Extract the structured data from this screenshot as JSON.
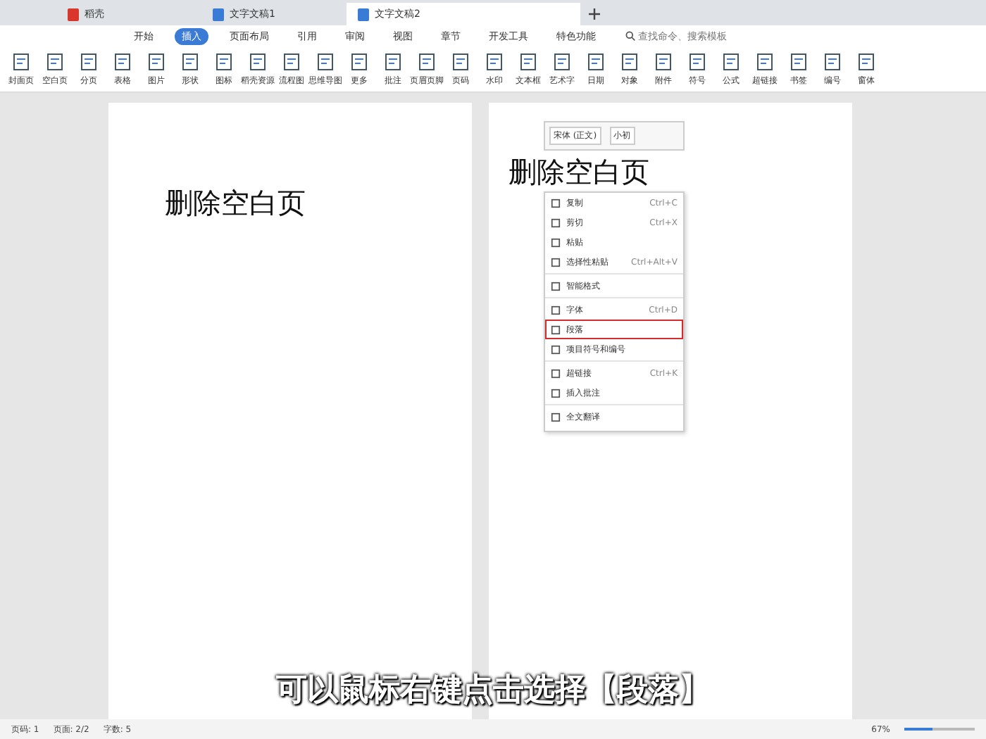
{
  "tabs": [
    {
      "label": "稻壳",
      "kind": "app",
      "selected": false
    },
    {
      "label": "文字文稿1",
      "kind": "doc",
      "selected": false
    },
    {
      "label": "文字文稿2",
      "kind": "doc",
      "selected": true
    }
  ],
  "menu": [
    {
      "label": "开始",
      "selected": false
    },
    {
      "label": "插入",
      "selected": true
    },
    {
      "label": "页面布局",
      "selected": false
    },
    {
      "label": "引用",
      "selected": false
    },
    {
      "label": "审阅",
      "selected": false
    },
    {
      "label": "视图",
      "selected": false
    },
    {
      "label": "章节",
      "selected": false
    },
    {
      "label": "开发工具",
      "selected": false
    },
    {
      "label": "特色功能",
      "selected": false
    }
  ],
  "search": {
    "placeholder": "查找命令、搜索模板"
  },
  "ribbon": [
    {
      "label": "封面页"
    },
    {
      "label": "空白页"
    },
    {
      "label": "分页"
    },
    {
      "label": "表格"
    },
    {
      "label": "图片"
    },
    {
      "label": "形状"
    },
    {
      "label": "图标"
    },
    {
      "label": "稻壳资源"
    },
    {
      "label": "流程图"
    },
    {
      "label": "思维导图"
    },
    {
      "label": "更多"
    },
    {
      "label": "批注"
    },
    {
      "label": "页眉页脚"
    },
    {
      "label": "页码"
    },
    {
      "label": "水印"
    },
    {
      "label": "文本框"
    },
    {
      "label": "艺术字"
    },
    {
      "label": "日期"
    },
    {
      "label": "对象"
    },
    {
      "label": "附件"
    },
    {
      "label": "符号"
    },
    {
      "label": "公式"
    },
    {
      "label": "超链接"
    },
    {
      "label": "书签"
    },
    {
      "label": "编号"
    },
    {
      "label": "窗体"
    }
  ],
  "pages": [
    {
      "heading": "删除空白页"
    },
    {
      "heading": "删除空白页"
    }
  ],
  "mini_toolbar": {
    "font": "宋体 (正文)",
    "size": "小初"
  },
  "context_menu": [
    {
      "label": "复制",
      "shortcut": "Ctrl+C",
      "selected": false,
      "divider": false
    },
    {
      "label": "剪切",
      "shortcut": "Ctrl+X",
      "selected": false,
      "divider": false
    },
    {
      "label": "粘贴",
      "selected": false,
      "divider": false
    },
    {
      "label": "选择性粘贴",
      "shortcut": "Ctrl+Alt+V",
      "selected": false,
      "divider": true
    },
    {
      "label": "智能格式",
      "selected": false,
      "divider": true
    },
    {
      "label": "字体",
      "shortcut": "Ctrl+D",
      "selected": false,
      "divider": false
    },
    {
      "label": "段落",
      "selected": true,
      "divider": false
    },
    {
      "label": "项目符号和编号",
      "selected": false,
      "divider": true
    },
    {
      "label": "超链接",
      "shortcut": "Ctrl+K",
      "selected": false,
      "divider": false
    },
    {
      "label": "插入批注",
      "selected": false,
      "divider": true
    },
    {
      "label": "全文翻译",
      "selected": false,
      "divider": false
    }
  ],
  "status_bar": {
    "items": [
      "页码: 1",
      "页面: 2/2",
      "字数: 5"
    ],
    "zoom": "67%",
    "zoom_slider": {
      "level": 0.4
    }
  },
  "subtitle": "可以鼠标右键点击选择【段落】"
}
